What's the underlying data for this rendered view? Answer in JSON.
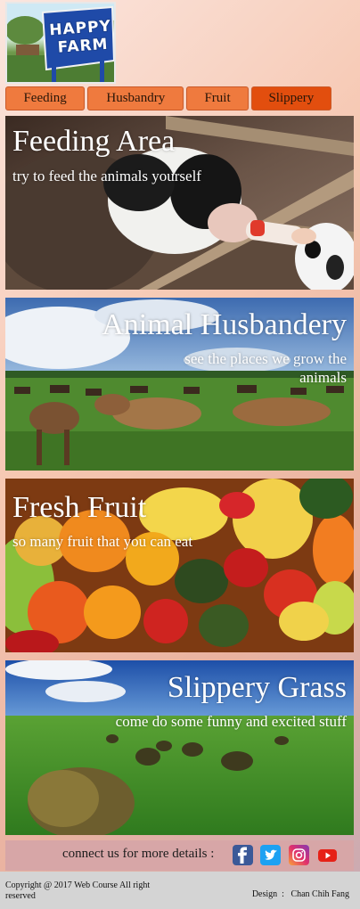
{
  "logo": {
    "text_line1": "HAPPY",
    "text_line2": "FARM"
  },
  "nav": {
    "tabs": [
      {
        "label": "Feeding",
        "active": false
      },
      {
        "label": "Husbandry",
        "active": false
      },
      {
        "label": "Fruit",
        "active": false
      },
      {
        "label": "Slippery",
        "active": true
      }
    ]
  },
  "sections": [
    {
      "title": "Feeding Area",
      "subtitle": "try to feed the animals yourself"
    },
    {
      "title": "Animal Husbandery",
      "subtitle": "see the places we grow the animals"
    },
    {
      "title": "Fresh Fruit",
      "subtitle": "so many fruit that you can eat"
    },
    {
      "title": "Slippery Grass",
      "subtitle": "come do some funny and excited stuff"
    }
  ],
  "contact": {
    "label": "connect us for more details :",
    "icons": [
      "facebook-icon",
      "twitter-icon",
      "instagram-icon",
      "youtube-icon"
    ]
  },
  "footer": {
    "copyright": "Copyright @ 2017 Web Course All right reserved",
    "design_label": "Design",
    "designer": "Chan Chih Fang"
  },
  "colors": {
    "tab_bg": "#ef7a3e",
    "tab_active_bg": "#e24e0e",
    "contact_bar": "#d7a6a7",
    "footer_bg": "#d4d4d4"
  }
}
